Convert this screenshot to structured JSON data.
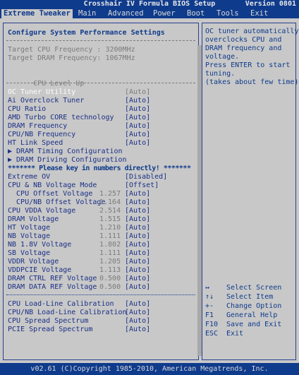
{
  "title": {
    "text": "Crosshair IV Formula BIOS Setup",
    "version": "Version 0801"
  },
  "menu": [
    "Extreme Tweaker",
    "Main",
    "Advanced",
    "Power",
    "Boot",
    "Tools",
    "Exit"
  ],
  "header": "Configure System Performance Settings",
  "target_cpu": "Target CPU Frequency : 3200MHz",
  "target_dram": "Target DRAM Frequency: 1067MHz",
  "cpu_level_up": {
    "label": "CPU Level Up",
    "value": "[Auto]"
  },
  "oc_tuner": "OC Tuner Utility",
  "settings": [
    {
      "label": "Ai Overclock Tuner",
      "value": "[Auto]"
    },
    {
      "label": "CPU Ratio",
      "value": "[Auto]"
    },
    {
      "label": "AMD Turbo CORE technology",
      "value": "[Auto]"
    },
    {
      "label": "DRAM Frequency",
      "value": "[Auto]"
    },
    {
      "label": "CPU/NB Frequency",
      "value": "[Auto]"
    },
    {
      "label": "HT Link Speed",
      "value": "[Auto]"
    }
  ],
  "submenus": [
    "▶ DRAM Timing Configuration",
    "▶ DRAM Driving Configuration"
  ],
  "warning": "******* Please key in numbers directly! *******",
  "voltages": [
    {
      "label": "Extreme OV",
      "num": "",
      "value": "[Disabled]"
    },
    {
      "label": "CPU & NB Voltage Mode",
      "num": "",
      "value": "[Offset]"
    },
    {
      "label": "  CPU Offset Voltage",
      "num": "1.257",
      "value": "[Auto]"
    },
    {
      "label": "  CPU/NB Offset Voltage",
      "num": "1.164",
      "value": "[Auto]"
    },
    {
      "label": "CPU VDDA Voltage",
      "num": "2.514",
      "value": "[Auto]"
    },
    {
      "label": "DRAM Voltage",
      "num": "1.515",
      "value": "[Auto]"
    },
    {
      "label": "HT Voltage",
      "num": "1.210",
      "value": "[Auto]"
    },
    {
      "label": "NB Voltage",
      "num": "1.111",
      "value": "[Auto]"
    },
    {
      "label": "NB 1.8V Voltage",
      "num": "1.802",
      "value": "[Auto]"
    },
    {
      "label": "SB Voltage",
      "num": "1.111",
      "value": "[Auto]"
    },
    {
      "label": "VDDR Voltage",
      "num": "1.205",
      "value": "[Auto]"
    },
    {
      "label": "VDDPCIE Voltage",
      "num": "1.113",
      "value": "[Auto]"
    },
    {
      "label": "DRAM CTRL REF Voltage",
      "num": "0.500",
      "value": "[Auto]"
    },
    {
      "label": "DRAM DATA REF Voltage",
      "num": "0.500",
      "value": "[Auto]"
    }
  ],
  "calibration": [
    {
      "label": "CPU Load-Line Calibration",
      "value": "[Auto]"
    },
    {
      "label": "CPU/NB Load-Line Calibration",
      "value": "[Auto]"
    },
    {
      "label": "CPU Spread Spectrum",
      "value": "[Auto]"
    },
    {
      "label": "PCIE Spread Spectrum",
      "value": "[Auto]"
    }
  ],
  "help_lines": [
    "OC tuner automatically",
    "overclocks CPU and",
    "DRAM frequency and",
    "voltage.",
    "Press ENTER to start",
    "tuning.",
    "(takes about few time)"
  ],
  "keys": [
    {
      "key": "↔",
      "desc": "Select Screen"
    },
    {
      "key": "↑↓",
      "desc": "Select Item"
    },
    {
      "key": "+-",
      "desc": "Change Option"
    },
    {
      "key": "F1",
      "desc": "General Help"
    },
    {
      "key": "F10",
      "desc": "Save and Exit"
    },
    {
      "key": "ESC",
      "desc": "Exit"
    }
  ],
  "footer": "v02.61 (C)Copyright 1985-2010, American Megatrends, Inc.",
  "colors": {
    "background": "#0f3b8c",
    "panel": "#c8c8c8",
    "highlight_text": "#ffffff",
    "muted": "#7b7b7b"
  }
}
